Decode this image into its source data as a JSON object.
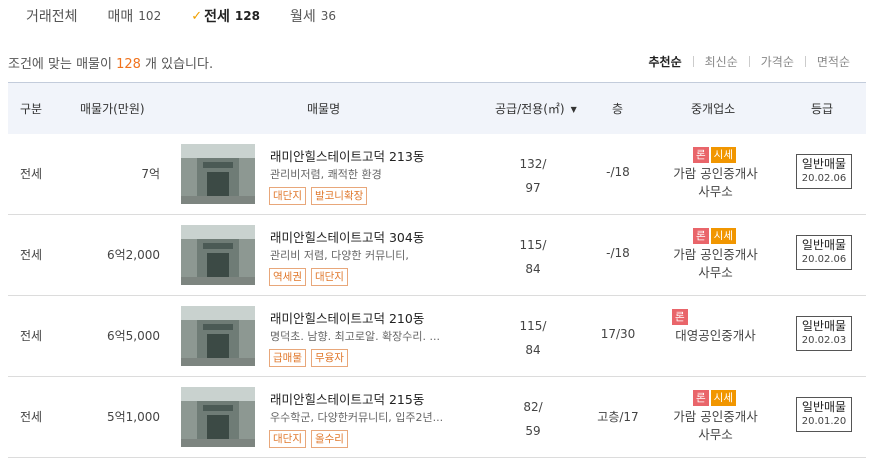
{
  "tabs": [
    {
      "label": "거래전체",
      "count": ""
    },
    {
      "label": "매매",
      "count": "102"
    },
    {
      "label": "전세",
      "count": "128"
    },
    {
      "label": "월세",
      "count": "36"
    }
  ],
  "summary": {
    "prefix": "조건에 맞는 매물이 ",
    "count": "128",
    "suffix": " 개 있습니다."
  },
  "sorts": [
    "추천순",
    "최신순",
    "가격순",
    "면적순"
  ],
  "columns": {
    "type": "구분",
    "price": "매물가(만원)",
    "name": "매물명",
    "area": "공급/전용(㎡)",
    "floor": "층",
    "agent": "중개업소",
    "grade": "등급"
  },
  "icons": {
    "check": "checkmark-icon",
    "sort_arrow": "sort-down-arrow-icon"
  },
  "colors": {
    "accent": "#f0731e",
    "ron_badge": "#e9656a",
    "sise_badge": "#f19600",
    "header_bg": "#f1f4fa"
  },
  "listings": [
    {
      "type": "전세",
      "price": "7억",
      "name": "래미안힐스테이트고덕 213동",
      "desc": "관리비저렴, 쾌적한 환경",
      "tags": [
        "대단지",
        "발코니확장"
      ],
      "area_supply": "132/",
      "area_exclusive": "97",
      "floor": "-/18",
      "badges": [
        "론",
        "시세"
      ],
      "agent_line1": "가람 공인중개사",
      "agent_line2": "사무소",
      "grade": "일반매물",
      "date": "20.02.06"
    },
    {
      "type": "전세",
      "price": "6억2,000",
      "name": "래미안힐스테이트고덕 304동",
      "desc": "관리비 저렴, 다양한 커뮤니티,",
      "tags": [
        "역세권",
        "대단지"
      ],
      "area_supply": "115/",
      "area_exclusive": "84",
      "floor": "-/18",
      "badges": [
        "론",
        "시세"
      ],
      "agent_line1": "가람 공인중개사",
      "agent_line2": "사무소",
      "grade": "일반매물",
      "date": "20.02.06"
    },
    {
      "type": "전세",
      "price": "6억5,000",
      "name": "래미안힐스테이트고덕 210동",
      "desc": "명덕초. 남향. 최고로알. 확장수리. ...",
      "tags": [
        "급매물",
        "무융자"
      ],
      "area_supply": "115/",
      "area_exclusive": "84",
      "floor": "17/30",
      "badges": [
        "론"
      ],
      "agent_line1": "대영공인중개사",
      "agent_line2": "",
      "grade": "일반매물",
      "date": "20.02.03"
    },
    {
      "type": "전세",
      "price": "5억1,000",
      "name": "래미안힐스테이트고덕 215동",
      "desc": "우수학군, 다양한커뮤니티, 입주2년...",
      "tags": [
        "대단지",
        "올수리"
      ],
      "area_supply": "82/",
      "area_exclusive": "59",
      "floor": "고층/17",
      "badges": [
        "론",
        "시세"
      ],
      "agent_line1": "가람 공인중개사",
      "agent_line2": "사무소",
      "grade": "일반매물",
      "date": "20.01.20"
    }
  ]
}
